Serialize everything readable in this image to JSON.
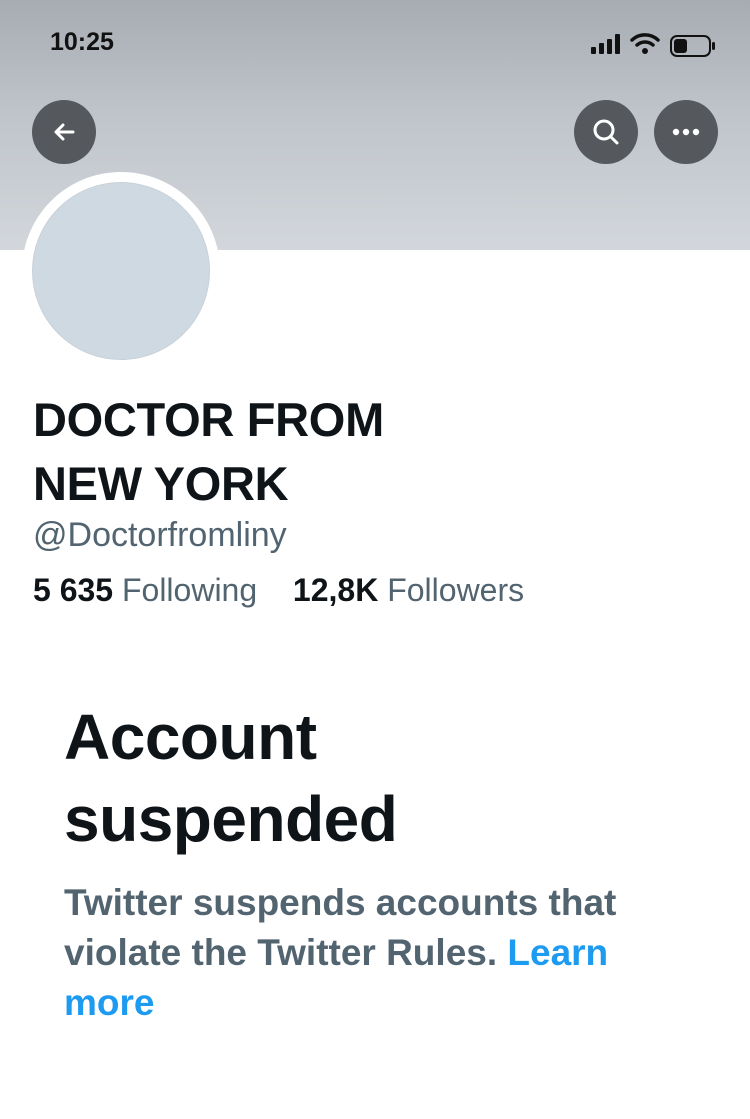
{
  "status_bar": {
    "time": "10:25",
    "icons": [
      "signal-icon",
      "wifi-icon",
      "battery-icon"
    ]
  },
  "header": {
    "buttons": [
      "back-icon",
      "search-icon",
      "more-icon"
    ],
    "banner_color": "#bfc4ca"
  },
  "profile": {
    "name_line1": "DOCTOR FROM",
    "name_line2": "NEW YORK",
    "handle": "@Doctorfromliny",
    "following_count": "5 635",
    "following_label": "Following",
    "followers_count": "12,8K",
    "followers_label": "Followers"
  },
  "suspension": {
    "title_line1": "Account",
    "title_line2": "suspended",
    "message": "Twitter suspends accounts that violate the Twitter Rules.",
    "link_line1": "Learn",
    "link_line2": "more"
  },
  "colors": {
    "text_primary": "#0f1419",
    "text_secondary": "#536471",
    "link": "#1d9bf0",
    "button_bg": "#55595d",
    "avatar_placeholder": "#cfd9e1"
  }
}
